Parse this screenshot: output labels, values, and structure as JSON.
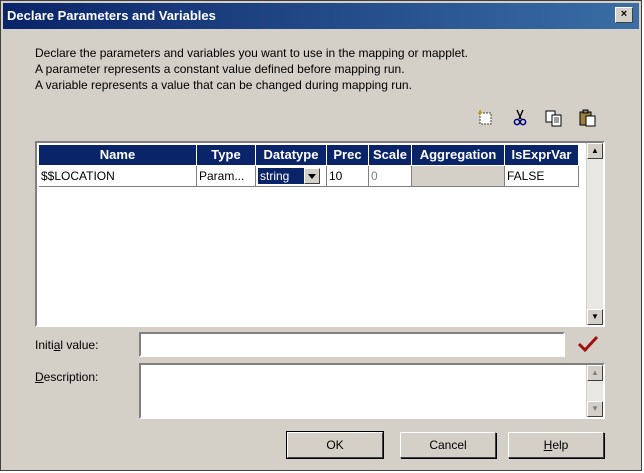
{
  "window": {
    "title": "Declare Parameters and Variables",
    "close_glyph": "×"
  },
  "intro": {
    "line1": "Declare the parameters and variables you want to use in the mapping or mapplet.",
    "line2": "A parameter represents a constant value defined before mapping run.",
    "line3": "A variable represents a value that can be changed during mapping run."
  },
  "toolbar": {
    "icons": [
      "new-icon",
      "cut-icon",
      "copy-icon",
      "paste-icon"
    ]
  },
  "grid": {
    "columns": [
      "Name",
      "Type",
      "Datatype",
      "Prec",
      "Scale",
      "Aggregation",
      "IsExprVar"
    ],
    "rows": [
      {
        "name": "$$LOCATION",
        "type": "Param...",
        "datatype": "string",
        "prec": "10",
        "scale": "0",
        "aggregation": "",
        "isexprvar": "FALSE"
      }
    ]
  },
  "initial_value": {
    "label_prefix": "Initi",
    "label_key": "a",
    "label_suffix": "l value:",
    "value": ""
  },
  "description": {
    "label_key": "D",
    "label_suffix": "escription:",
    "value": ""
  },
  "buttons": {
    "ok": "OK",
    "cancel": "Cancel",
    "help_key": "H",
    "help_suffix": "elp"
  },
  "colors": {
    "title_bar": "#0a246a",
    "header": "#0a246a",
    "checkmark": "#a01010"
  }
}
